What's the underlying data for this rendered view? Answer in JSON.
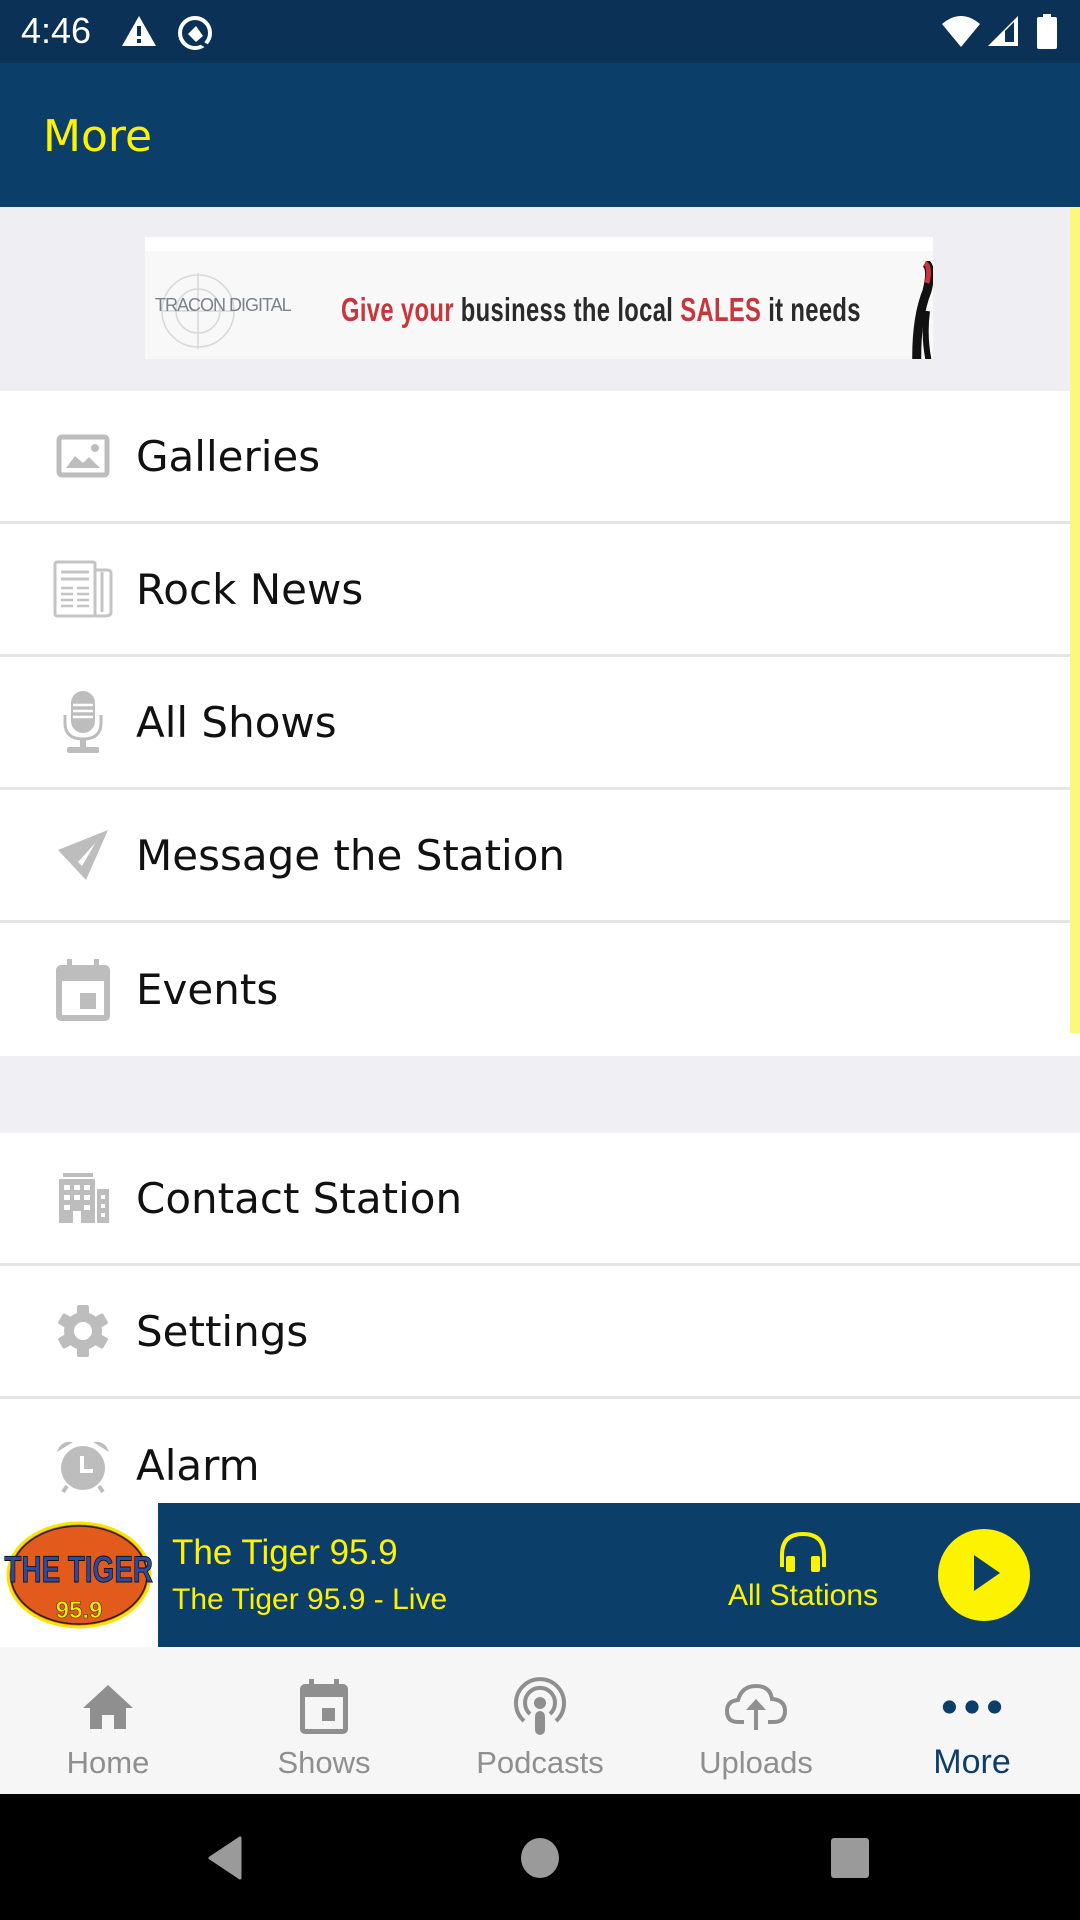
{
  "status_bar": {
    "time": "4:46",
    "left_icons": [
      "warning-icon",
      "data-saver-icon"
    ],
    "right_icons": [
      "wifi-icon",
      "cell-signal-icon",
      "battery-icon"
    ]
  },
  "app_bar": {
    "title": "More"
  },
  "ad_banner": {
    "brand": "TRACON DIGITAL",
    "text_parts": [
      {
        "text": "Give your ",
        "color": "#c8353a"
      },
      {
        "text": "business the local ",
        "color": "#2a2a2a"
      },
      {
        "text": "SALES",
        "color": "#c8353a"
      },
      {
        "text": " it needs",
        "color": "#2a2a2a"
      }
    ]
  },
  "menu": {
    "group1": [
      {
        "label": "Galleries",
        "icon": "image-icon"
      },
      {
        "label": "Rock News",
        "icon": "newspaper-icon"
      },
      {
        "label": "All Shows",
        "icon": "microphone-icon"
      },
      {
        "label": "Message the Station",
        "icon": "send-icon"
      },
      {
        "label": "Events",
        "icon": "calendar-icon"
      }
    ],
    "group2": [
      {
        "label": "Contact Station",
        "icon": "building-icon"
      },
      {
        "label": "Settings",
        "icon": "gear-icon"
      },
      {
        "label": "Alarm",
        "icon": "alarm-clock-icon"
      }
    ]
  },
  "player": {
    "logo_text": "THE TIGER",
    "logo_frequency": "95.9",
    "title": "The Tiger 95.9",
    "subtitle": "The Tiger 95.9  - Live",
    "all_stations_label": "All Stations"
  },
  "bottom_nav": {
    "items": [
      {
        "label": "Home",
        "icon": "home-icon",
        "active": false
      },
      {
        "label": "Shows",
        "icon": "calendar-icon",
        "active": false
      },
      {
        "label": "Podcasts",
        "icon": "podcast-icon",
        "active": false
      },
      {
        "label": "Uploads",
        "icon": "cloud-upload-icon",
        "active": false
      },
      {
        "label": "More",
        "icon": "more-dots-icon",
        "active": true
      }
    ]
  },
  "colors": {
    "primary": "#0c3e6a",
    "status_bar": "#0b3157",
    "accent": "#fdf200",
    "icon_gray": "#bdbdbd",
    "nav_inactive": "#8f8f8f"
  }
}
